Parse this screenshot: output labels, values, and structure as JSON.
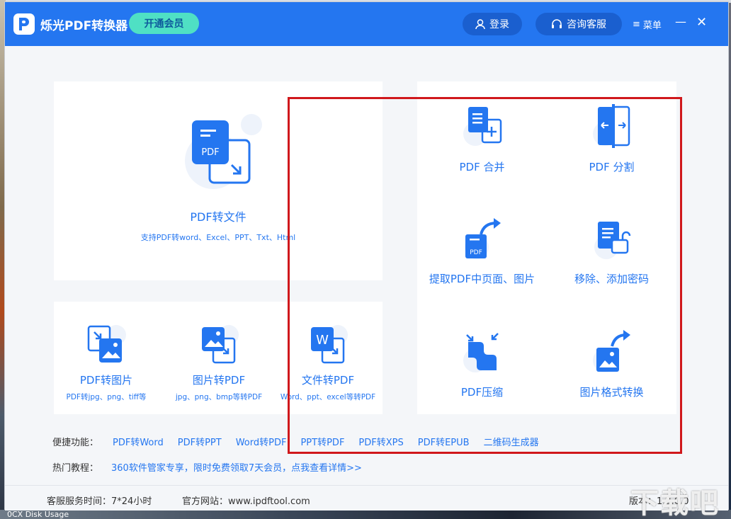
{
  "desktop": {
    "taskbar_text": "0CX  Disk Usage"
  },
  "titlebar": {
    "app_title": "烁光PDF转换器",
    "vip_label": "开通会员",
    "login_label": "登录",
    "service_label": "咨询客服",
    "menu_label": "菜单"
  },
  "main_card": {
    "title": "PDF转文件",
    "subtitle": "支持PDF转word、Excel、PPT、Txt、Html",
    "icon_text": "PDF"
  },
  "small_tiles": [
    {
      "title": "PDF转图片",
      "subtitle": "PDF转jpg、png、tiff等"
    },
    {
      "title": "图片转PDF",
      "subtitle": "jpg、png、bmp等转PDF"
    },
    {
      "title": "文件转PDF",
      "subtitle": "Word、ppt、excel等转PDF",
      "icon_text": "W"
    }
  ],
  "right_tiles": [
    {
      "title": "PDF 合并"
    },
    {
      "title": "PDF 分割"
    },
    {
      "title": "提取PDF中页面、图片",
      "icon_text": "PDF"
    },
    {
      "title": "移除、添加密码"
    },
    {
      "title": "PDF压缩"
    },
    {
      "title": "图片格式转换"
    }
  ],
  "quick": {
    "label": "便捷功能：",
    "links": [
      "PDF转Word",
      "PDF转PPT",
      "Word转PDF",
      "PPT转PDF",
      "PDF转XPS",
      "PDF转EPUB",
      "二维码生成器"
    ]
  },
  "hot": {
    "label": "热门教程：",
    "link": "360软件管家专享，限时免费领取7天会员，点我查看详情>>"
  },
  "footer": {
    "service_time": "客服服务时间：7*24小时",
    "website": "官方网站：www.ipdftool.com",
    "version": "版本：1.3.0.0"
  },
  "watermark": "下载吧",
  "colors": {
    "brand": "#2476f0",
    "vip": "#4fe0c4",
    "highlight": "#d0181c"
  }
}
